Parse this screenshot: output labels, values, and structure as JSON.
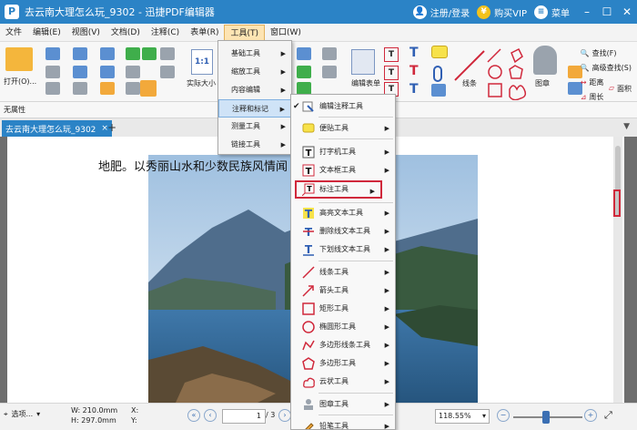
{
  "window": {
    "title": "去云南大理怎么玩_9302 - 迅捷PDF编辑器",
    "login": "注册/登录",
    "buy": "购买VIP",
    "menu": "菜单"
  },
  "menubar": [
    "文件",
    "编辑(E)",
    "视图(V)",
    "文档(D)",
    "注释(C)",
    "表单(R)",
    "工具(T)",
    "窗口(W)"
  ],
  "toolbar": {
    "open_label": "打开(O)...",
    "actual_size": "实际大小",
    "actual_size_icon": "1:1",
    "edit_form": "编辑表单",
    "line": "线条",
    "stamp": "图章",
    "distance": "距离",
    "perimeter": "周长",
    "area": "面积",
    "find": "查找(F)",
    "advanced_find": "高级查找(S)"
  },
  "attr_bar": "无属性",
  "tab": {
    "label": "去云南大理怎么玩_9302",
    "close": "×",
    "add": "+"
  },
  "document": {
    "text": "地肥。以秀丽山水和少数民族风情闻"
  },
  "status": {
    "select_label": "选项...",
    "width": "W: 210.0mm",
    "height": "H: 297.0mm",
    "x": "X:",
    "y": "Y:",
    "page_current": "1",
    "page_total": "/ 3",
    "zoom": "118.55%"
  },
  "tools_menu": {
    "items": [
      {
        "label": "基础工具"
      },
      {
        "label": "缩放工具"
      },
      {
        "label": "内容编辑"
      },
      {
        "label": "注释和标记"
      },
      {
        "label": "测量工具"
      },
      {
        "label": "链接工具"
      }
    ]
  },
  "annot_submenu": {
    "items": [
      {
        "label": "编辑注释工具",
        "icon": "edit-annotation-icon"
      },
      {
        "label": "便贴工具",
        "icon": "sticky-note-icon"
      },
      {
        "label": "打字机工具",
        "icon": "typewriter-icon"
      },
      {
        "label": "文本框工具",
        "icon": "textbox-icon"
      },
      {
        "label": "标注工具",
        "icon": "callout-icon"
      },
      {
        "label": "高亮文本工具",
        "icon": "highlight-text-icon"
      },
      {
        "label": "删除线文本工具",
        "icon": "strikethrough-icon"
      },
      {
        "label": "下划线文本工具",
        "icon": "underline-icon"
      },
      {
        "label": "线条工具",
        "icon": "line-icon"
      },
      {
        "label": "箭头工具",
        "icon": "arrow-icon"
      },
      {
        "label": "矩形工具",
        "icon": "rectangle-icon"
      },
      {
        "label": "椭圆形工具",
        "icon": "ellipse-icon"
      },
      {
        "label": "多边形线条工具",
        "icon": "polyline-icon"
      },
      {
        "label": "多边形工具",
        "icon": "polygon-icon"
      },
      {
        "label": "云状工具",
        "icon": "cloud-icon"
      },
      {
        "label": "图章工具",
        "icon": "stamp-icon"
      },
      {
        "label": "铅笔工具",
        "icon": "pencil-icon"
      }
    ]
  },
  "colors": {
    "titlebar": "#2b83c6",
    "accent_red": "#d0283b",
    "menu_highlight": "#cfe3f7"
  }
}
